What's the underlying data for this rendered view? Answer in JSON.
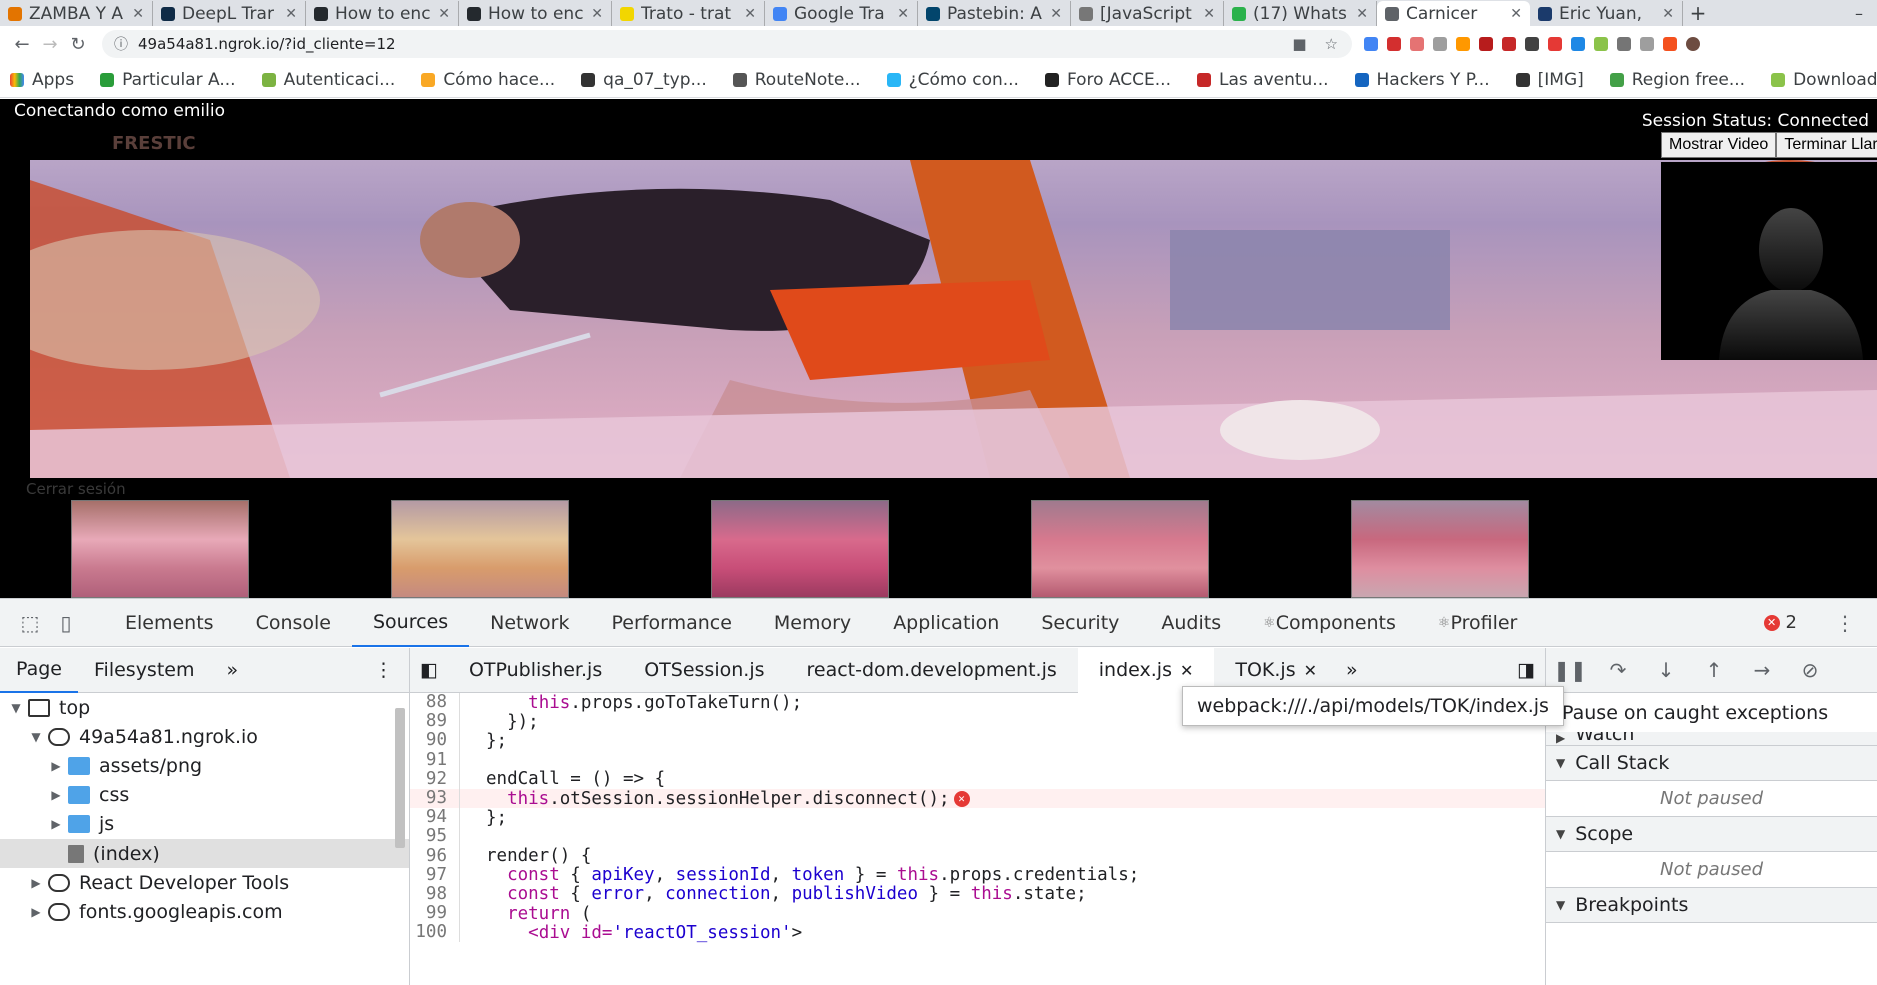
{
  "browser": {
    "tabs": [
      {
        "title": "ZAMBA Y A",
        "color": "#e37400"
      },
      {
        "title": "DeepL Trar",
        "color": "#0f2b46"
      },
      {
        "title": "How to enc",
        "color": "#24292e"
      },
      {
        "title": "How to enc",
        "color": "#24292e"
      },
      {
        "title": "Trato - trat",
        "color": "#f2d600"
      },
      {
        "title": "Google Tra",
        "color": "#4285f4"
      },
      {
        "title": "Pastebin: A",
        "color": "#02456c"
      },
      {
        "title": "[JavaScript",
        "color": "#777777"
      },
      {
        "title": "(17) Whats",
        "color": "#2bb24c"
      },
      {
        "title": "Carnicer",
        "color": "#5f6368"
      },
      {
        "title": "Eric Yuan,",
        "color": "#1b3a6b"
      }
    ],
    "url": "49a54a81.ngrok.io/?id_cliente=12",
    "apps_label": "Apps",
    "bookmarks": [
      {
        "label": "Particular A...",
        "color": "#2a9d3a"
      },
      {
        "label": "Autenticaci...",
        "color": "#7cb342"
      },
      {
        "label": "Cómo hace...",
        "color": "#f9a825"
      },
      {
        "label": "qa_07_typ...",
        "color": "#333333"
      },
      {
        "label": "RouteNote...",
        "color": "#555555"
      },
      {
        "label": "¿Cómo con...",
        "color": "#29b6f6"
      },
      {
        "label": "Foro ACCE...",
        "color": "#222222"
      },
      {
        "label": "Las aventu...",
        "color": "#c62828"
      },
      {
        "label": "Hackers Y P...",
        "color": "#1565c0"
      },
      {
        "label": "[IMG]",
        "color": "#333333"
      },
      {
        "label": "Region free...",
        "color": "#43a047"
      },
      {
        "label": "Downloadi...",
        "color": "#8bc34a"
      }
    ]
  },
  "page": {
    "connecting": "Conectando como emilio",
    "logo": "FRESTIC",
    "logout": "Cerrar sesión",
    "session_status": "Session Status: Connected",
    "show_video": "Mostrar Video",
    "end_call": "Terminar Llar"
  },
  "devtools": {
    "tabs": [
      "Elements",
      "Console",
      "Sources",
      "Network",
      "Performance",
      "Memory",
      "Application",
      "Security",
      "Audits",
      "Components",
      "Profiler"
    ],
    "error_count": "2",
    "navigator_tabs": [
      "Page",
      "Filesystem"
    ],
    "tree": [
      {
        "label": "top",
        "depth": 0,
        "arrow": "▼",
        "icon": "top"
      },
      {
        "label": "49a54a81.ngrok.io",
        "depth": 1,
        "arrow": "▼",
        "icon": "cloud"
      },
      {
        "label": "assets/png",
        "depth": 2,
        "arrow": "▶",
        "icon": "folder"
      },
      {
        "label": "css",
        "depth": 2,
        "arrow": "▶",
        "icon": "folder"
      },
      {
        "label": "js",
        "depth": 2,
        "arrow": "▶",
        "icon": "folder"
      },
      {
        "label": "(index)",
        "depth": 2,
        "arrow": "",
        "icon": "file",
        "selected": true
      },
      {
        "label": "React Developer Tools",
        "depth": 1,
        "arrow": "▶",
        "icon": "cloud"
      },
      {
        "label": "fonts.googleapis.com",
        "depth": 1,
        "arrow": "▶",
        "icon": "cloud"
      }
    ],
    "editor_tabs": [
      {
        "label": "OTPublisher.js",
        "close": false
      },
      {
        "label": "OTSession.js",
        "close": false
      },
      {
        "label": "react-dom.development.js",
        "close": false
      },
      {
        "label": "index.js",
        "close": true,
        "active": true
      },
      {
        "label": "TOK.js",
        "close": true
      }
    ],
    "tooltip": "webpack:///./api/models/TOK/index.js",
    "code": [
      {
        "n": "88",
        "t": "    this.props.goToTakeTurn();"
      },
      {
        "n": "89",
        "t": "  });"
      },
      {
        "n": "90",
        "t": "};"
      },
      {
        "n": "91",
        "t": ""
      },
      {
        "n": "92",
        "t": "endCall = () => {"
      },
      {
        "n": "93",
        "t": "  this.otSession.sessionHelper.disconnect();",
        "error": true
      },
      {
        "n": "94",
        "t": "};"
      },
      {
        "n": "95",
        "t": ""
      },
      {
        "n": "96",
        "t": "render() {"
      },
      {
        "n": "97",
        "t": "  const { apiKey, sessionId, token } = this.props.credentials;"
      },
      {
        "n": "98",
        "t": "  const { error, connection, publishVideo } = this.state;"
      },
      {
        "n": "99",
        "t": "  return ("
      },
      {
        "n": "100",
        "t": "    <div id='reactOT_session'>"
      }
    ],
    "debugger": {
      "pause_exceptions": "Pause on caught exceptions",
      "watch": "Watch",
      "call_stack": "Call Stack",
      "call_stack_status": "Not paused",
      "scope": "Scope",
      "scope_status": "Not paused",
      "breakpoints": "Breakpoints"
    }
  }
}
